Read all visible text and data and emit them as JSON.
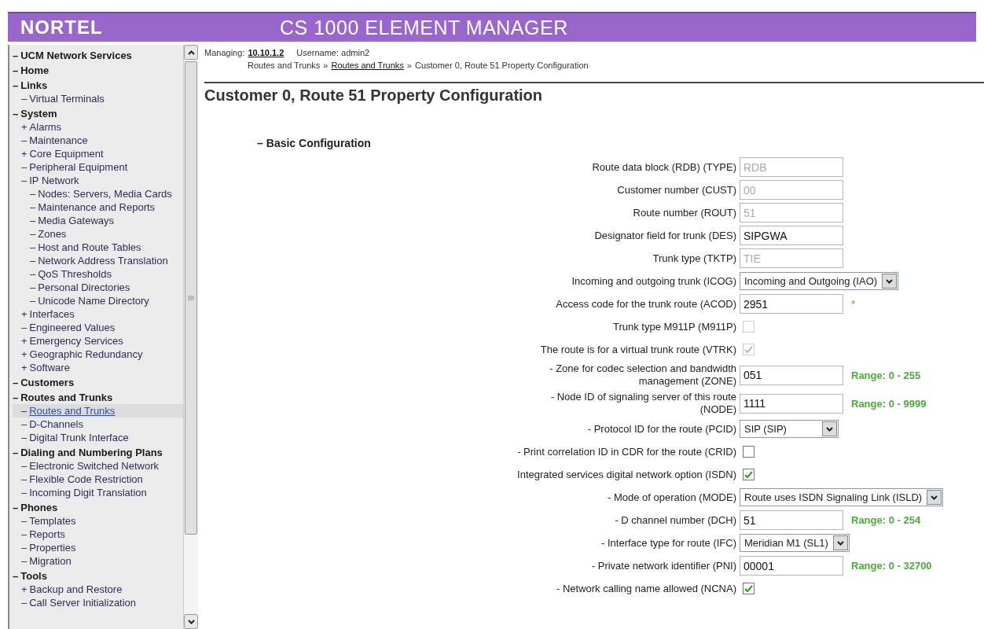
{
  "header": {
    "logo": "NORTEL",
    "title": "CS 1000 ELEMENT MANAGER"
  },
  "sidebar": {
    "items": [
      {
        "sign": "–",
        "label": "UCM Network Services",
        "selected": false
      },
      {
        "sign": "–",
        "label": "Home",
        "selected": false
      },
      {
        "sign": "–",
        "label": "Links",
        "selected": false,
        "children": [
          {
            "sign": "–",
            "label": "Virtual Terminals",
            "selected": false
          }
        ]
      },
      {
        "sign": "–",
        "label": "System",
        "selected": false,
        "children": [
          {
            "sign": "+",
            "label": "Alarms",
            "selected": false
          },
          {
            "sign": "–",
            "label": "Maintenance",
            "selected": false
          },
          {
            "sign": "+",
            "label": "Core Equipment",
            "selected": false
          },
          {
            "sign": "–",
            "label": "Peripheral Equipment",
            "selected": false
          },
          {
            "sign": "–",
            "label": "IP Network",
            "selected": false,
            "children": [
              {
                "sign": "–",
                "label": "Nodes: Servers, Media Cards",
                "selected": false
              },
              {
                "sign": "–",
                "label": "Maintenance and Reports",
                "selected": false
              },
              {
                "sign": "–",
                "label": "Media Gateways",
                "selected": false
              },
              {
                "sign": "–",
                "label": "Zones",
                "selected": false
              },
              {
                "sign": "–",
                "label": "Host and Route Tables",
                "selected": false
              },
              {
                "sign": "–",
                "label": "Network Address Translation",
                "selected": false
              },
              {
                "sign": "–",
                "label": "QoS Thresholds",
                "selected": false
              },
              {
                "sign": "–",
                "label": "Personal Directories",
                "selected": false
              },
              {
                "sign": "–",
                "label": "Unicode Name Directory",
                "selected": false
              }
            ]
          },
          {
            "sign": "+",
            "label": "Interfaces",
            "selected": false
          },
          {
            "sign": "–",
            "label": "Engineered Values",
            "selected": false
          },
          {
            "sign": "+",
            "label": "Emergency Services",
            "selected": false
          },
          {
            "sign": "+",
            "label": "Geographic Redundancy",
            "selected": false
          },
          {
            "sign": "+",
            "label": "Software",
            "selected": false
          }
        ]
      },
      {
        "sign": "–",
        "label": "Customers",
        "selected": false
      },
      {
        "sign": "–",
        "label": "Routes and Trunks",
        "selected": false,
        "children": [
          {
            "sign": "–",
            "label": "Routes and Trunks",
            "selected": true
          },
          {
            "sign": "–",
            "label": "D-Channels",
            "selected": false
          },
          {
            "sign": "–",
            "label": "Digital Trunk Interface",
            "selected": false
          }
        ]
      },
      {
        "sign": "–",
        "label": "Dialing and Numbering Plans",
        "selected": false,
        "children": [
          {
            "sign": "–",
            "label": "Electronic Switched Network",
            "selected": false
          },
          {
            "sign": "–",
            "label": "Flexible Code Restriction",
            "selected": false
          },
          {
            "sign": "–",
            "label": "Incoming Digit Translation",
            "selected": false
          }
        ]
      },
      {
        "sign": "–",
        "label": "Phones",
        "selected": false,
        "children": [
          {
            "sign": "–",
            "label": "Templates",
            "selected": false
          },
          {
            "sign": "–",
            "label": "Reports",
            "selected": false
          },
          {
            "sign": "–",
            "label": "Properties",
            "selected": false
          },
          {
            "sign": "–",
            "label": "Migration",
            "selected": false
          }
        ]
      },
      {
        "sign": "–",
        "label": "Tools",
        "selected": false,
        "children": [
          {
            "sign": "+",
            "label": "Backup and Restore",
            "selected": false
          },
          {
            "sign": "–",
            "label": "Call Server Initialization",
            "selected": false
          }
        ]
      }
    ]
  },
  "context": {
    "managing_label": "Managing:",
    "managing_value": "10.10.1.2",
    "username": "Username: admin2"
  },
  "breadcrumb": [
    {
      "kind": "text",
      "text": "Routes and Trunks"
    },
    {
      "kind": "text",
      "text": "»"
    },
    {
      "kind": "link",
      "text": "Routes and Trunks"
    },
    {
      "kind": "text",
      "text": "»"
    },
    {
      "kind": "text",
      "text": "Customer 0, Route 51 Property Configuration"
    }
  ],
  "page_title": "Customer 0, Route 51 Property Configuration",
  "section": {
    "sign": "–",
    "title": "Basic Configuration"
  },
  "fields": [
    {
      "kind": "text",
      "label": "Route data block (RDB) (TYPE)",
      "value": "RDB",
      "disabled": true
    },
    {
      "kind": "text",
      "label": "Customer number (CUST)",
      "value": "00",
      "disabled": true
    },
    {
      "kind": "text",
      "label": "Route number (ROUT)",
      "value": "51",
      "disabled": true
    },
    {
      "kind": "text",
      "label": "Designator field for trunk (DES)",
      "value": "SIPGWA",
      "disabled": false
    },
    {
      "kind": "text",
      "label": "Trunk type (TKTP)",
      "value": "TIE",
      "disabled": true
    },
    {
      "kind": "select",
      "label": "Incoming and outgoing trunk  (ICOG)",
      "value": "Incoming and Outgoing (IAO)"
    },
    {
      "kind": "text",
      "label": "Access code for the trunk route (ACOD)",
      "value": "2951",
      "disabled": false,
      "required": "*"
    },
    {
      "kind": "checkbox",
      "label": "Trunk type M911P (M911P)",
      "checked": false,
      "disabled": true
    },
    {
      "kind": "checkbox",
      "label": "The route is for a virtual trunk route (VTRK)",
      "checked": true,
      "disabled": true
    },
    {
      "kind": "text",
      "label": "- Zone for codec selection and bandwidth management (ZONE)",
      "value": "051",
      "disabled": false,
      "range": "Range: 0 - 255"
    },
    {
      "kind": "text",
      "label": "- Node ID of signaling server of this route (NODE)",
      "value": "1111",
      "disabled": false,
      "range": "Range: 0 - 9999"
    },
    {
      "kind": "select",
      "label": "- Protocol ID for the route (PCID)",
      "value": "SIP (SIP)"
    },
    {
      "kind": "checkbox",
      "label": "- Print correlation ID in CDR for the route (CRID)",
      "checked": false,
      "disabled": false
    },
    {
      "kind": "checkbox",
      "label": "Integrated services digital network option (ISDN)",
      "checked": true,
      "disabled": false
    },
    {
      "kind": "select",
      "label": "- Mode of operation (MODE)",
      "value": "Route uses ISDN Signaling Link (ISLD)"
    },
    {
      "kind": "text",
      "label": "- D channel number (DCH)",
      "value": "51",
      "disabled": false,
      "range": "Range: 0 - 254"
    },
    {
      "kind": "select",
      "label": "- Interface type for route (IFC)",
      "value": "Meridian M1 (SL1)"
    },
    {
      "kind": "text",
      "label": "- Private network identifier (PNI)",
      "value": "00001",
      "disabled": false,
      "range": "Range: 0 - 32700"
    },
    {
      "kind": "checkbox",
      "label": "- Network calling name allowed (NCNA)",
      "checked": true,
      "disabled": false
    }
  ]
}
